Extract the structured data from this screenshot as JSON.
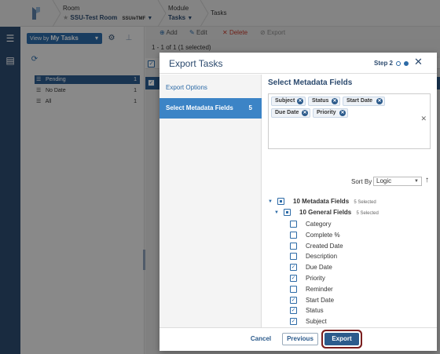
{
  "topbar": {
    "room_label": "Room",
    "room_name": "SSU-Test Room",
    "room_badge": "SSU/eTMF",
    "module_label": "Module",
    "module_name": "Tasks",
    "page": "Tasks"
  },
  "left_panel": {
    "view_by_prefix": "View by",
    "view_by_value": "My Tasks",
    "filters": [
      {
        "label": "Pending",
        "count": "1"
      },
      {
        "label": "No Date",
        "count": "1"
      },
      {
        "label": "All",
        "count": "1"
      }
    ]
  },
  "toolbar": {
    "add": "Add",
    "edit": "Edit",
    "delete": "Delete",
    "export": "Export"
  },
  "grid": {
    "count_text": "1 - 1 of 1 (1 selected)"
  },
  "modal": {
    "title": "Export Tasks",
    "step": "Step 2",
    "nav": [
      {
        "label": "Export Options",
        "count": ""
      },
      {
        "label": "Select Metadata Fields",
        "count": "5"
      }
    ],
    "section_title": "Select Metadata Fields",
    "chips": [
      "Subject",
      "Status",
      "Start Date",
      "Due Date",
      "Priority"
    ],
    "sort_by_label": "Sort By",
    "sort_by_value": "Logic",
    "tree": {
      "root_label": "10 Metadata Fields",
      "root_selected": "5 Selected",
      "group_label": "10 General Fields",
      "group_selected": "5 Selected"
    },
    "fields": [
      {
        "label": "Category",
        "checked": false
      },
      {
        "label": "Complete %",
        "checked": false
      },
      {
        "label": "Created Date",
        "checked": false
      },
      {
        "label": "Description",
        "checked": false
      },
      {
        "label": "Due Date",
        "checked": true
      },
      {
        "label": "Priority",
        "checked": true
      },
      {
        "label": "Reminder",
        "checked": false
      },
      {
        "label": "Start Date",
        "checked": true
      },
      {
        "label": "Status",
        "checked": true
      },
      {
        "label": "Subject",
        "checked": true
      }
    ],
    "buttons": {
      "cancel": "Cancel",
      "previous": "Previous",
      "export": "Export"
    }
  },
  "colors": {
    "brand": "#2c4a6e",
    "accent": "#2c6aa6",
    "active_nav": "#3c84c6",
    "delete": "#c0392b",
    "export_highlight": "#7a1f1f"
  }
}
